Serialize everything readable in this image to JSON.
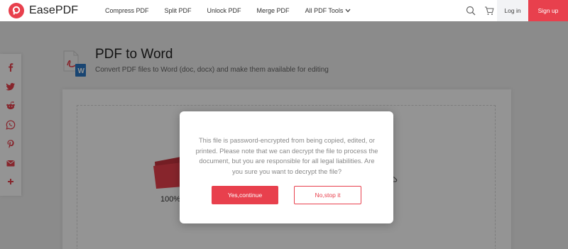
{
  "brand": {
    "name": "EasePDF",
    "accent": "#e8404d"
  },
  "nav": [
    {
      "label": "Compress PDF"
    },
    {
      "label": "Split PDF"
    },
    {
      "label": "Unlock PDF"
    },
    {
      "label": "Merge PDF"
    },
    {
      "label": "All PDF Tools"
    }
  ],
  "header": {
    "login_label": "Log in",
    "signup_label": "Sign up"
  },
  "page": {
    "title": "PDF to Word",
    "subtitle": "Convert PDF files to Word (doc, docx) and make them available for editing",
    "progress_text": "100%"
  },
  "social": [
    "facebook-icon",
    "twitter-icon",
    "reddit-icon",
    "whatsapp-icon",
    "pinterest-icon",
    "email-icon",
    "plus-icon"
  ],
  "modal": {
    "message": "This file is password-encrypted from being copied, edited, or printed. Please note that we can decrypt the file to process the document, but you are responsible for all legal liabilities. Are you sure you want to decrypt the file?",
    "confirm_label": "Yes,continue",
    "cancel_label": "No,stop it"
  }
}
